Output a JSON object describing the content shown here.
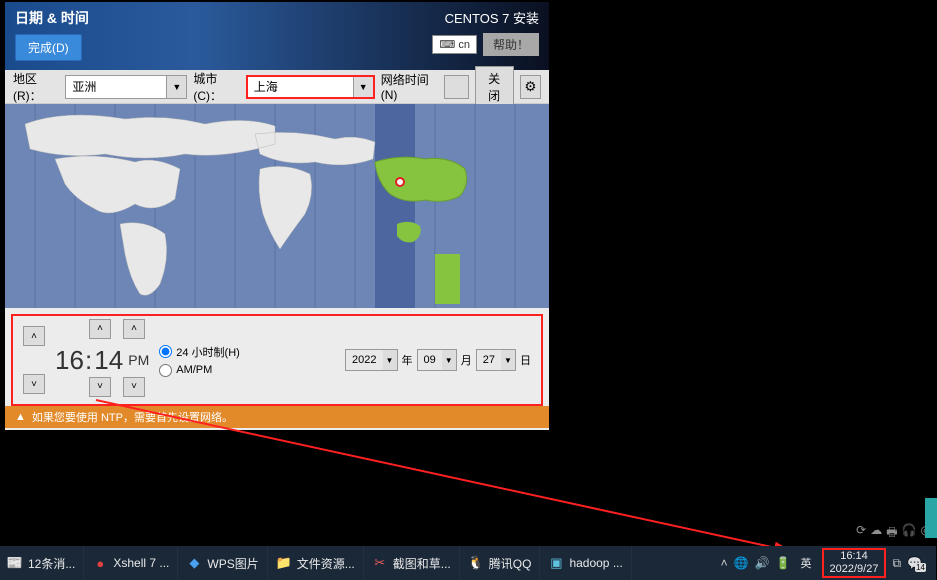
{
  "header": {
    "title": "日期 & 时间",
    "done": "完成(D)",
    "installer_title": "CENTOS 7 安装",
    "lang_code": "cn",
    "help": "帮助！"
  },
  "toolbar": {
    "region_label": "地区(R)：",
    "region_value": "亚洲",
    "city_label": "城市(C)：",
    "city_value": "上海",
    "network_label": "网络时间(N)",
    "network_value": "关闭"
  },
  "time": {
    "hour": "16",
    "minute": "14",
    "ampm": "PM",
    "fmt24_label": "24 小时制(H)",
    "ampm_label": "AM/PM",
    "year": "2022",
    "month": "09",
    "day": "27",
    "year_suffix": "年",
    "month_suffix": "月",
    "day_suffix": "日"
  },
  "warning": {
    "text": "如果您要使用 NTP，需要首先设置网络。"
  },
  "taskbar": {
    "items": [
      {
        "label": "12条消...",
        "icon": "📰",
        "color": "#e0e0e0"
      },
      {
        "label": "Xshell 7 ...",
        "icon": "●",
        "color": "#e04040"
      },
      {
        "label": "WPS图片",
        "icon": "◆",
        "color": "#4aa0f0"
      },
      {
        "label": "文件资源...",
        "icon": "📁",
        "color": "#f0c040"
      },
      {
        "label": "截图和草...",
        "icon": "✂",
        "color": "#f05a5a"
      },
      {
        "label": "腾讯QQ",
        "icon": "🐧",
        "color": "#e0e0e0"
      },
      {
        "label": "hadoop ...",
        "icon": "▣",
        "color": "#60c0e0"
      }
    ],
    "lang": "英",
    "time": "16:14",
    "date": "2022/9/27",
    "tray_badge": "14"
  }
}
